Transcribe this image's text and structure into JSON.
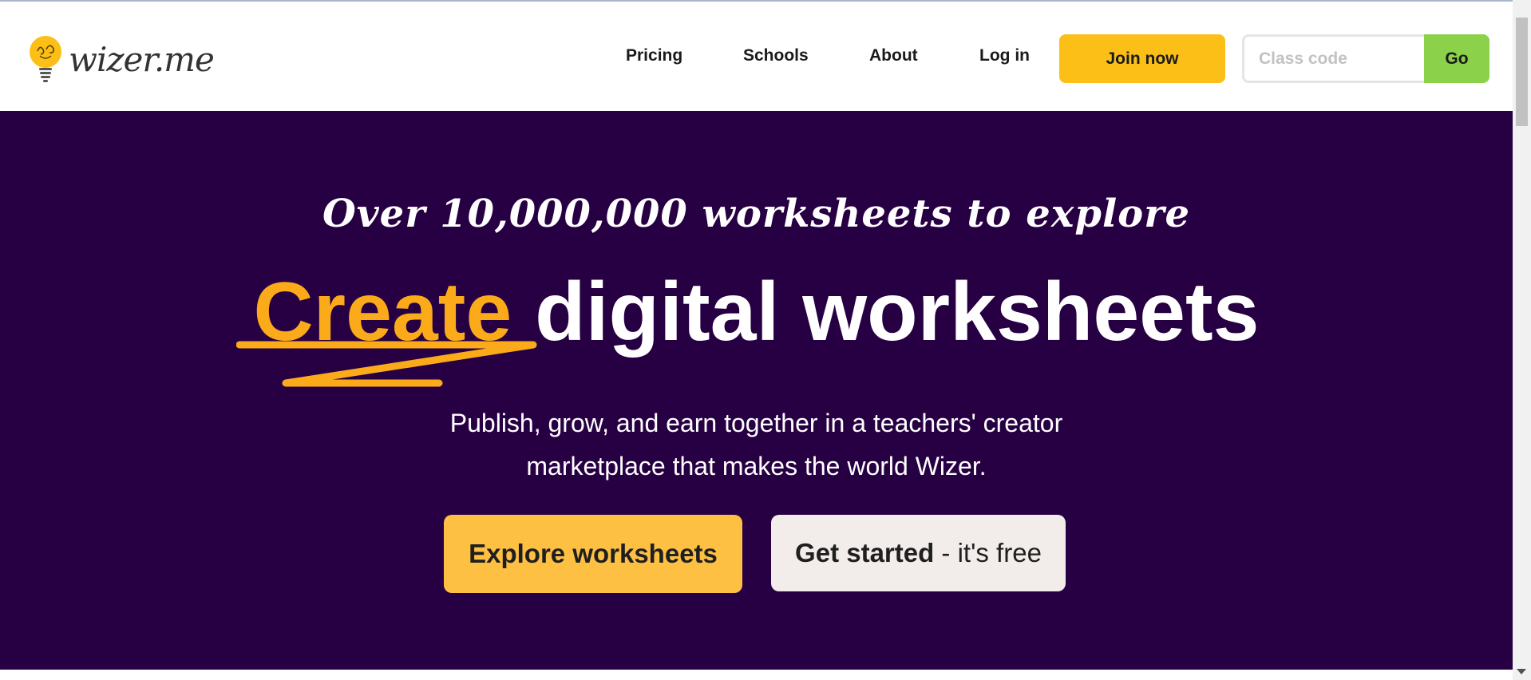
{
  "header": {
    "logo_text": "wizer.me",
    "nav": {
      "pricing": "Pricing",
      "schools": "Schools",
      "about": "About",
      "login": "Log in"
    },
    "join_label": "Join now",
    "class_code_placeholder": "Class code",
    "go_label": "Go"
  },
  "hero": {
    "tagline": "Over 10,000,000 worksheets to explore",
    "headline_accent": "Create",
    "headline_rest": " digital worksheets",
    "subtext_line1": "Publish, grow, and earn together in a teachers' creator",
    "subtext_line2": "marketplace that makes the world Wizer.",
    "explore_label": "Explore worksheets",
    "started_bold": "Get started",
    "started_rest": " - it's free"
  },
  "colors": {
    "hero_bg": "#270043",
    "accent": "#fbaa1a",
    "join_button": "#fbbf18",
    "go_button": "#8cd14a",
    "explore_button": "#fec043",
    "started_button": "#f2edea"
  },
  "icons": {
    "logo": "lightbulb-icon"
  }
}
